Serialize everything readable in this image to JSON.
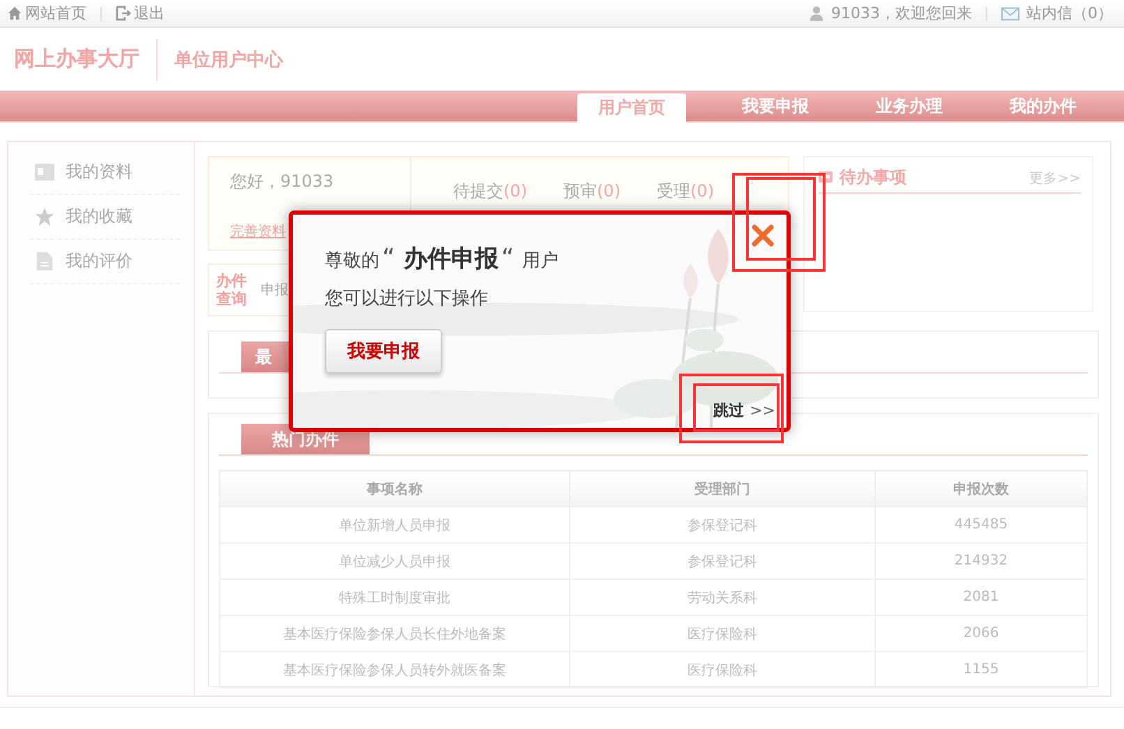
{
  "top_bar": {
    "links": [
      {
        "label": "网站首页"
      },
      {
        "label": "退出"
      }
    ],
    "user": "91033，欢迎您回来",
    "messages": "站内信（0）"
  },
  "header": {
    "site_title": "网上办事大厅",
    "subtitle": "单位用户中心"
  },
  "nav": [
    {
      "label": "用户首页",
      "selected": true
    },
    {
      "label": "我要申报",
      "selected": false
    },
    {
      "label": "业务办理",
      "selected": false
    },
    {
      "label": "我的办件",
      "selected": false
    }
  ],
  "sidebar": [
    {
      "label": "我的资料"
    },
    {
      "label": "我的收藏"
    },
    {
      "label": "我的评价"
    }
  ],
  "greeting": {
    "text": "您好，91033",
    "link": "完善资料"
  },
  "stats": [
    {
      "label": "待提交",
      "count": "(0)"
    },
    {
      "label": "预审",
      "count": "(0)"
    },
    {
      "label": "受理",
      "count": "(0)"
    }
  ],
  "query": {
    "title": "办件查询",
    "text": "申报"
  },
  "recent_tab": "最",
  "todo": {
    "title": "待办事项",
    "more": "更多>>"
  },
  "hot": {
    "tab": "热门办件",
    "columns": [
      "事项名称",
      "受理部门",
      "申报次数"
    ],
    "rows": [
      [
        "单位新增人员申报",
        "参保登记科",
        "445485"
      ],
      [
        "单位减少人员申报",
        "参保登记科",
        "214932"
      ],
      [
        "特殊工时制度审批",
        "劳动关系科",
        "2081"
      ],
      [
        "基本医疗保险参保人员长住外地备案",
        "医疗保险科",
        "2066"
      ],
      [
        "基本医疗保险参保人员转外就医备案",
        "医疗保险科",
        "1155"
      ]
    ]
  },
  "modal": {
    "prefix": "尊敬的",
    "open_quote": "“",
    "role": "办件申报",
    "close_quote": "“",
    "suffix": "用户",
    "message": "您可以进行以下操作",
    "action": "我要申报",
    "skip": "跳过",
    "skip_arrow": ">>"
  }
}
